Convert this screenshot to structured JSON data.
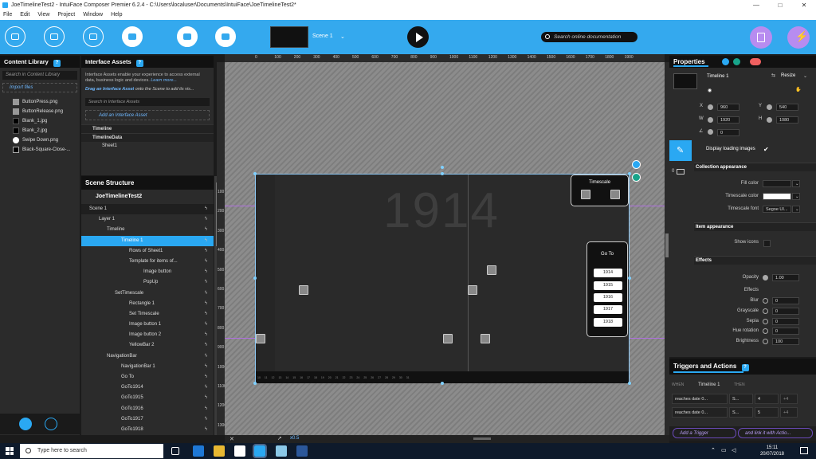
{
  "window": {
    "title": "JoeTimelineTest2 - IntuiFace Composer Premier 6.2.4 - C:\\Users\\localuser\\Documents\\IntuiFace\\JoeTimelineTest2*",
    "minimize": "—",
    "maximize": "□",
    "close": "✕"
  },
  "menu": [
    "File",
    "Edit",
    "View",
    "Project",
    "Window",
    "Help"
  ],
  "toolbar": {
    "scene_label": "Scene 1",
    "scene_caret": "⌄",
    "search_placeholder": "Search online documentation"
  },
  "content_library": {
    "title": "Content Library",
    "help": "?",
    "search_placeholder": "Search in Content Library",
    "import": "Import files",
    "items": [
      {
        "name": "ButtonPress.png",
        "icon": "image-thumb"
      },
      {
        "name": "ButtonRelease.png",
        "icon": "image-thumb"
      },
      {
        "name": "Blank_1.jpg",
        "icon": "image-thumb"
      },
      {
        "name": "Blank_2.jpg",
        "icon": "image-thumb"
      },
      {
        "name": "Swipe Down.png",
        "icon": "hand-icon"
      },
      {
        "name": "Black-Square-Close-...",
        "icon": "close-thumb"
      }
    ]
  },
  "interface_assets": {
    "title": "Interface Assets",
    "help": "?",
    "description": "Interface Assets enable your experience to access external data, business logic and devices.",
    "learn_more": "Learn more...",
    "drag_hint_strong": "Drag an Interface Asset",
    "drag_hint_rest": "onto the Scene to add its vis...",
    "search_placeholder": "Search in Interface Assets",
    "add": "Add an Interface Asset",
    "groups": [
      {
        "label": "Timeline",
        "children": []
      },
      {
        "label": "TimelineData",
        "children": [
          "Sheet1"
        ]
      }
    ]
  },
  "scene_structure": {
    "title": "Scene Structure",
    "project": "JoeTimelineTest2",
    "rows": [
      {
        "label": "Scene 1",
        "indent": 10,
        "style": "dark"
      },
      {
        "label": "Layer 1",
        "indent": 22,
        "style": ""
      },
      {
        "label": "Timeline",
        "indent": 32,
        "style": ""
      },
      {
        "label": "Timeline 1",
        "indent": 50,
        "style": "sel"
      },
      {
        "label": "Rows of  Sheet1",
        "indent": 60,
        "style": ""
      },
      {
        "label": "Template for items of...",
        "indent": 60,
        "style": ""
      },
      {
        "label": "Image button",
        "indent": 78,
        "style": ""
      },
      {
        "label": "PopUp",
        "indent": 78,
        "style": ""
      },
      {
        "label": "SetTimescale",
        "indent": 42,
        "style": ""
      },
      {
        "label": "Rectangle 1",
        "indent": 60,
        "style": ""
      },
      {
        "label": "Set Timescale",
        "indent": 60,
        "style": ""
      },
      {
        "label": "Image button 1",
        "indent": 60,
        "style": ""
      },
      {
        "label": "Image button 2",
        "indent": 60,
        "style": ""
      },
      {
        "label": "YellowBar 2",
        "indent": 60,
        "style": ""
      },
      {
        "label": "NavigationBar",
        "indent": 32,
        "style": ""
      },
      {
        "label": "NavigationBar 1",
        "indent": 50,
        "style": ""
      },
      {
        "label": "Go To",
        "indent": 50,
        "style": ""
      },
      {
        "label": "GoTo1914",
        "indent": 50,
        "style": ""
      },
      {
        "label": "GoTo1915",
        "indent": 50,
        "style": ""
      },
      {
        "label": "GoTo1916",
        "indent": 50,
        "style": ""
      },
      {
        "label": "GoTo1917",
        "indent": 50,
        "style": ""
      },
      {
        "label": "GoTo1918",
        "indent": 50,
        "style": ""
      }
    ]
  },
  "ruler": {
    "top": [
      "0",
      "100",
      "200",
      "300",
      "400",
      "500",
      "600",
      "700",
      "800",
      "900",
      "1000",
      "1100",
      "1200",
      "1300",
      "1400",
      "1500",
      "1600",
      "1700",
      "1800",
      "1900"
    ],
    "left": [
      "100",
      "200",
      "300",
      "400",
      "500",
      "600",
      "700",
      "800",
      "900",
      "1000",
      "1100",
      "1200",
      "1300"
    ]
  },
  "stage": {
    "big_year": "1914",
    "timescale_label": "Timescale",
    "goto_label": "Go To",
    "goto_items": [
      "1914",
      "1915",
      "1916",
      "1917",
      "1918"
    ],
    "zoom": "x0.5",
    "tick_labels": [
      "10",
      "11",
      "12",
      "13",
      "14",
      "15",
      "16",
      "17",
      "18",
      "19",
      "20",
      "21",
      "22",
      "23",
      "24",
      "25",
      "26",
      "27",
      "28",
      "29",
      "30",
      "31"
    ]
  },
  "properties": {
    "title": "Properties",
    "element_name": "Timeline 1",
    "resize": "Resize",
    "x_label": "X",
    "x": "960",
    "y_label": "Y",
    "y": "540",
    "w_label": "W",
    "w": "1920",
    "h_label": "H",
    "h": "1080",
    "angle": "0",
    "display_loading": "Display loading images",
    "collection_appearance": "Collection appearance",
    "fill_color": "Fill color",
    "timescale_color": "Timescale color",
    "timescale_font": "Timescale font",
    "timescale_font_value": "Segoe UI...",
    "item_appearance": "Item appearance",
    "show_icons": "Show icons",
    "effects": "Effects",
    "opacity": "Opacity",
    "opacity_value": "1.00",
    "effects_sub": "Effects",
    "blur": "Blur",
    "blur_v": "0",
    "grayscale": "Grayscale",
    "grayscale_v": "0",
    "sepia": "Sepia",
    "sepia_v": "0",
    "hue": "Hue rotation",
    "hue_v": "0",
    "brightness": "Brightness",
    "brightness_v": "100",
    "side_index": "0"
  },
  "triggers": {
    "title": "Triggers and Actions",
    "help": "?",
    "when": "WHEN",
    "then": "THEN",
    "source": "Timeline 1",
    "rows": [
      {
        "trigger": "reaches date 0...",
        "action": "S...",
        "target": "4",
        "count": "+4"
      },
      {
        "trigger": "reaches date 0...",
        "action": "S...",
        "target": "5",
        "count": "+4"
      }
    ],
    "add_trigger": "Add a Trigger",
    "link_action": "and link it with Actio..."
  },
  "taskbar": {
    "search_placeholder": "Type here to search",
    "time": "15:11",
    "date": "20/07/2018"
  },
  "colors": {
    "accent": "#2aa8f2",
    "toolbar": "#34a9ee",
    "purple": "#b78cf0"
  }
}
